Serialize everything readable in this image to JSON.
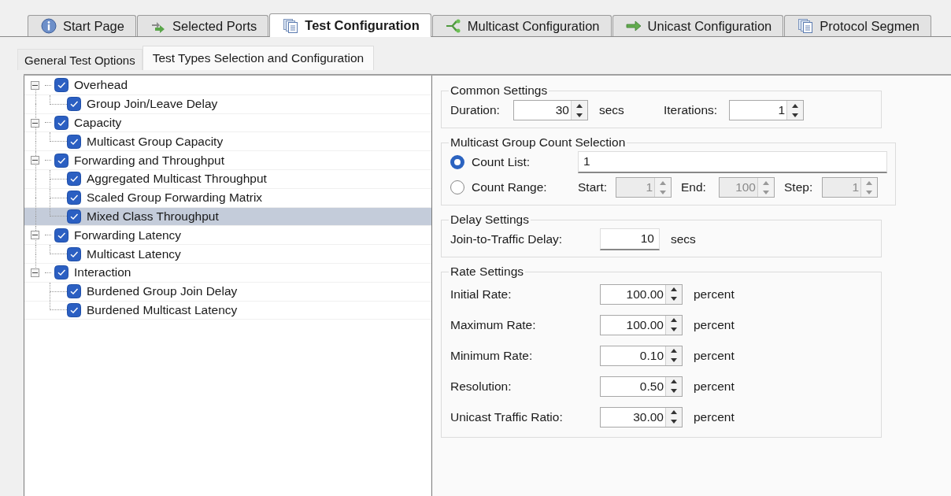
{
  "tabs": [
    {
      "label": "Start Page",
      "selected": false
    },
    {
      "label": "Selected Ports",
      "selected": false
    },
    {
      "label": "Test Configuration",
      "selected": true
    },
    {
      "label": "Multicast Configuration",
      "selected": false
    },
    {
      "label": "Unicast Configuration",
      "selected": false
    },
    {
      "label": "Protocol Segmen",
      "selected": false
    }
  ],
  "subtabs": [
    {
      "label": "General Test Options",
      "selected": false
    },
    {
      "label": "Test Types Selection and Configuration",
      "selected": true
    }
  ],
  "tree": [
    {
      "label": "Overhead",
      "checked": true,
      "expanded": true,
      "selected": false,
      "children": [
        {
          "label": "Group Join/Leave Delay",
          "checked": true,
          "selected": false
        }
      ]
    },
    {
      "label": "Capacity",
      "checked": true,
      "expanded": true,
      "selected": false,
      "children": [
        {
          "label": "Multicast Group Capacity",
          "checked": true,
          "selected": false
        }
      ]
    },
    {
      "label": "Forwarding and Throughput",
      "checked": true,
      "expanded": true,
      "selected": false,
      "children": [
        {
          "label": "Aggregated Multicast Throughput",
          "checked": true,
          "selected": false
        },
        {
          "label": "Scaled Group Forwarding Matrix",
          "checked": true,
          "selected": false
        },
        {
          "label": "Mixed Class Throughput",
          "checked": true,
          "selected": true
        }
      ]
    },
    {
      "label": "Forwarding Latency",
      "checked": true,
      "expanded": true,
      "selected": false,
      "children": [
        {
          "label": "Multicast Latency",
          "checked": true,
          "selected": false
        }
      ]
    },
    {
      "label": "Interaction",
      "checked": true,
      "expanded": true,
      "selected": false,
      "children": [
        {
          "label": "Burdened Group Join Delay",
          "checked": true,
          "selected": false
        },
        {
          "label": "Burdened Multicast Latency",
          "checked": true,
          "selected": false
        }
      ]
    }
  ],
  "common_settings": {
    "title": "Common Settings",
    "duration": {
      "label": "Duration:",
      "value": "30",
      "unit": "secs"
    },
    "iterations": {
      "label": "Iterations:",
      "value": "1"
    }
  },
  "group_count": {
    "title": "Multicast Group Count Selection",
    "count_list": {
      "label": "Count List:",
      "selected": true,
      "value": "1"
    },
    "count_range": {
      "label": "Count Range:",
      "selected": false,
      "disabled": true,
      "fields": [
        {
          "label": "Start:",
          "value": "1"
        },
        {
          "label": "End:",
          "value": "100"
        },
        {
          "label": "Step:",
          "value": "1"
        }
      ]
    }
  },
  "delay_settings": {
    "title": "Delay Settings",
    "label": "Join-to-Traffic Delay:",
    "value": "10",
    "unit": "secs"
  },
  "rate_settings": {
    "title": "Rate Settings",
    "rows": [
      {
        "label": "Initial Rate:",
        "value": "100.00",
        "unit": "percent"
      },
      {
        "label": "Maximum Rate:",
        "value": "100.00",
        "unit": "percent"
      },
      {
        "label": "Minimum Rate:",
        "value": "0.10",
        "unit": "percent"
      },
      {
        "label": "Resolution:",
        "value": "0.50",
        "unit": "percent"
      },
      {
        "label": "Unicast Traffic Ratio:",
        "value": "30.00",
        "unit": "percent"
      }
    ]
  }
}
